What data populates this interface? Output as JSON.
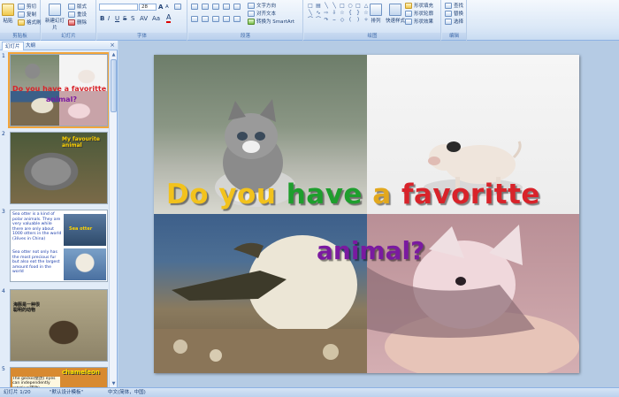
{
  "ribbon": {
    "clipboard": {
      "label": "剪贴板",
      "paste": "粘贴",
      "cut": "剪切",
      "copy": "复制",
      "format_painter": "格式刷"
    },
    "slides": {
      "label": "幻灯片",
      "new_slide": "新建幻灯片",
      "layout": "版式",
      "reset": "重设",
      "delete": "删除"
    },
    "font": {
      "label": "字体",
      "font_size": "28"
    },
    "paragraph": {
      "label": "段落",
      "text_direction": "文字方向",
      "align_text": "对齐文本",
      "smartart": "转换为 SmartArt"
    },
    "drawing": {
      "label": "绘图",
      "arrange": "排列",
      "quick_styles": "快速样式",
      "shape_fill": "形状填充",
      "shape_outline": "形状轮廓",
      "shape_effects": "形状效果"
    },
    "editing": {
      "label": "编辑",
      "find": "查找",
      "replace": "替换",
      "select": "选择"
    }
  },
  "panel": {
    "tab_slides": "幻灯片",
    "tab_outline": "大纲",
    "close": "×",
    "thumbs": [
      {
        "num": "1",
        "title": "Do you have a favoritte",
        "sub": "animal?"
      },
      {
        "num": "2",
        "caption": "My favourite animal"
      },
      {
        "num": "3",
        "text": "Sea otter is a kind of polar animals. They are very valuable while there are only about 1000 otters in the world (3lives in China)",
        "text2": "Sea otter not only has the most precious fur but also eat the largest amount food in the world",
        "label": "Sea otter"
      },
      {
        "num": "4",
        "caption": "海豚是一种很聪明的动物"
      },
      {
        "num": "5",
        "caption": "chameleon",
        "text": "The gecko(壁虎) eyes can independently rotating(转动)."
      }
    ]
  },
  "slide": {
    "title_words": [
      {
        "text": "Do",
        "color": "#f2c21c"
      },
      {
        "text": "you",
        "color": "#f2c21c"
      },
      {
        "text": "have",
        "color": "#1e9e2d"
      },
      {
        "text": "a",
        "color": "#e2a81e"
      },
      {
        "text": "favoritte",
        "color": "#d8232a"
      }
    ],
    "subtitle": "animal?"
  },
  "status": {
    "slide_info": "幻灯片 1/20",
    "theme": "\"默认设计模板\"",
    "language": "中文(简体，中国)"
  }
}
